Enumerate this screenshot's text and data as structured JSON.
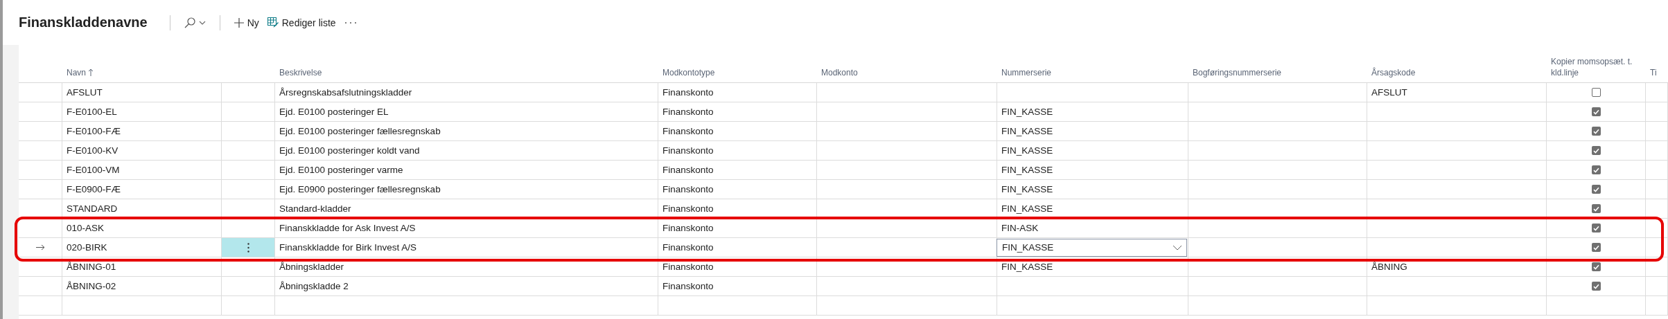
{
  "page": {
    "title": "Finanskladdenavne"
  },
  "toolbar": {
    "new_label": "Ny",
    "edit_label": "Rediger liste"
  },
  "table": {
    "columns": [
      {
        "label": "Navn",
        "sorted": true
      },
      {
        "label": "Beskrivelse",
        "sorted": false
      },
      {
        "label": "Modkontotype",
        "sorted": false
      },
      {
        "label": "Modkonto",
        "sorted": false
      },
      {
        "label": "Nummerserie",
        "sorted": false
      },
      {
        "label": "Bogføringsnummerserie",
        "sorted": false
      },
      {
        "label": "Årsagskode",
        "sorted": false
      },
      {
        "label": "Kopier momsopsæt. t. kld.linje",
        "sorted": false
      },
      {
        "label": "Ti",
        "sorted": false
      }
    ],
    "rows": [
      {
        "name": "AFSLUT",
        "description": "Årsregnskabsafslutningskladder",
        "account_type": "Finanskonto",
        "number_series": "",
        "reason_code": "AFSLUT",
        "copy_vat": false,
        "selected": false,
        "highlighted": false
      },
      {
        "name": "F-E0100-EL",
        "description": "Ejd. E0100 posteringer EL",
        "account_type": "Finanskonto",
        "number_series": "FIN_KASSE",
        "reason_code": "",
        "copy_vat": true,
        "selected": false,
        "highlighted": false
      },
      {
        "name": "F-E0100-FÆ",
        "description": "Ejd. E0100 posteringer fællesregnskab",
        "account_type": "Finanskonto",
        "number_series": "FIN_KASSE",
        "reason_code": "",
        "copy_vat": true,
        "selected": false,
        "highlighted": false
      },
      {
        "name": "F-E0100-KV",
        "description": "Ejd. E0100 posteringer koldt vand",
        "account_type": "Finanskonto",
        "number_series": "FIN_KASSE",
        "reason_code": "",
        "copy_vat": true,
        "selected": false,
        "highlighted": false
      },
      {
        "name": "F-E0100-VM",
        "description": "Ejd. E0100 posteringer varme",
        "account_type": "Finanskonto",
        "number_series": "FIN_KASSE",
        "reason_code": "",
        "copy_vat": true,
        "selected": false,
        "highlighted": false
      },
      {
        "name": "F-E0900-FÆ",
        "description": "Ejd. E0900 posteringer fællesregnskab",
        "account_type": "Finanskonto",
        "number_series": "FIN_KASSE",
        "reason_code": "",
        "copy_vat": true,
        "selected": false,
        "highlighted": false
      },
      {
        "name": "STANDARD",
        "description": "Standard-kladder",
        "account_type": "Finanskonto",
        "number_series": "FIN_KASSE",
        "reason_code": "",
        "copy_vat": true,
        "selected": false,
        "highlighted": false
      },
      {
        "name": "010-ASK",
        "description": "Finanskkladde for Ask Invest A/S",
        "account_type": "Finanskonto",
        "number_series": "FIN-ASK",
        "reason_code": "",
        "copy_vat": true,
        "selected": false,
        "highlighted": true
      },
      {
        "name": "020-BIRK",
        "description": "Finanskkladde for Birk Invest A/S",
        "account_type": "Finanskonto",
        "number_series": "FIN_KASSE",
        "reason_code": "",
        "copy_vat": true,
        "selected": true,
        "highlighted": true
      },
      {
        "name": "ÅBNING-01",
        "description": "Åbningskladder",
        "account_type": "Finanskonto",
        "number_series": "FIN_KASSE",
        "reason_code": "ÅBNING",
        "copy_vat": true,
        "selected": false,
        "highlighted": false
      },
      {
        "name": "ÅBNING-02",
        "description": "Åbningskladde 2",
        "account_type": "Finanskonto",
        "number_series": "",
        "reason_code": "",
        "copy_vat": true,
        "selected": false,
        "highlighted": false
      }
    ]
  }
}
